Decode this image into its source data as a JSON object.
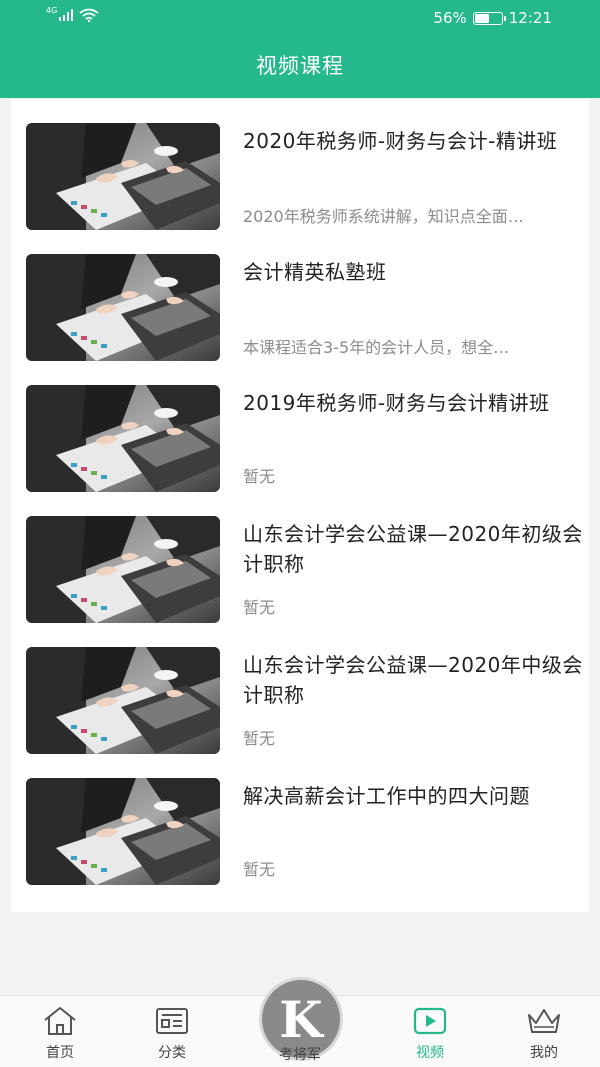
{
  "status_bar": {
    "network": "4G",
    "battery_percent": "56%",
    "battery_level": 0.56,
    "time": "12:21"
  },
  "header": {
    "title": "视频课程"
  },
  "courses": [
    {
      "title": "2020年税务师-财务与会计-精讲班",
      "description": "2020年税务师系统讲解，知识点全面…",
      "thumbnail": "business-meeting-laptop-photo"
    },
    {
      "title": "会计精英私塾班",
      "description": "本课程适合3-5年的会计人员，想全…",
      "thumbnail": "business-meeting-laptop-photo"
    },
    {
      "title": "2019年税务师-财务与会计精讲班",
      "description": "暂无",
      "thumbnail": "business-meeting-laptop-photo"
    },
    {
      "title": "山东会计学会公益课—2020年初级会计职称",
      "description": "暂无",
      "thumbnail": "business-meeting-laptop-photo"
    },
    {
      "title": "山东会计学会公益课—2020年中级会计职称",
      "description": "暂无",
      "thumbnail": "business-meeting-laptop-photo"
    },
    {
      "title": "解决高薪会计工作中的四大问题",
      "description": "暂无",
      "thumbnail": "business-meeting-laptop-photo"
    }
  ],
  "tabbar": {
    "home": {
      "label": "首页",
      "icon": "home-icon"
    },
    "category": {
      "label": "分类",
      "icon": "category-icon"
    },
    "center": {
      "label": "考将军",
      "logo_letter": "K"
    },
    "video": {
      "label": "视频",
      "icon": "play-video-icon",
      "active": true
    },
    "mine": {
      "label": "我的",
      "icon": "crown-icon"
    }
  },
  "colors": {
    "brand": "#25b88c",
    "background": "#f2f2f2",
    "muted_text": "#8c8c8c"
  }
}
